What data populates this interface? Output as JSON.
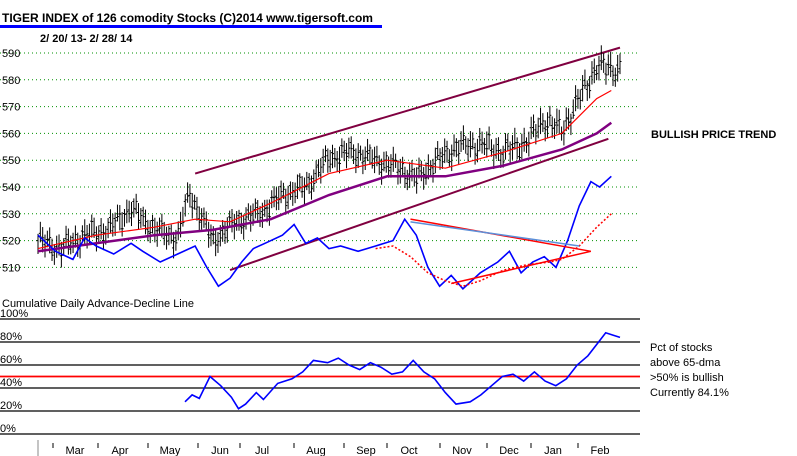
{
  "chart_data": [
    {
      "type": "candlestick",
      "title": "TIGER INDEX of  126 comodity Stocks  (C)2014  www.tigersoft.com",
      "date_range": "2/ 20/ 13-  2/ 28/ 14",
      "y_ticks": [
        "590",
        "580",
        "570",
        "560",
        "550",
        "540",
        "530",
        "520",
        "510"
      ],
      "ylim": [
        505,
        592
      ],
      "x_months": [
        "Mar",
        "Apr",
        "May",
        "Jun",
        "Jul",
        "Aug",
        "Sep",
        "Oct",
        "Nov",
        "Dec",
        "Jan",
        "Feb"
      ],
      "grid": "dotted-horizontal",
      "price_anchors": [
        [
          0,
          520
        ],
        [
          0.04,
          517
        ],
        [
          0.08,
          522
        ],
        [
          0.12,
          524
        ],
        [
          0.16,
          532
        ],
        [
          0.2,
          524
        ],
        [
          0.24,
          521
        ],
        [
          0.26,
          538
        ],
        [
          0.3,
          520
        ],
        [
          0.34,
          527
        ],
        [
          0.38,
          530
        ],
        [
          0.42,
          537
        ],
        [
          0.46,
          540
        ],
        [
          0.5,
          551
        ],
        [
          0.54,
          553
        ],
        [
          0.58,
          550
        ],
        [
          0.62,
          547
        ],
        [
          0.65,
          543
        ],
        [
          0.68,
          549
        ],
        [
          0.72,
          555
        ],
        [
          0.76,
          556
        ],
        [
          0.8,
          553
        ],
        [
          0.84,
          557
        ],
        [
          0.87,
          565
        ],
        [
          0.9,
          561
        ],
        [
          0.93,
          573
        ],
        [
          0.96,
          585
        ],
        [
          0.985,
          584
        ]
      ],
      "series": [
        {
          "name": "price",
          "color": "#000000"
        },
        {
          "name": "21-dma",
          "color": "#ff0000",
          "values": [
            [
              0,
              517
            ],
            [
              0.1,
              522
            ],
            [
              0.2,
              525
            ],
            [
              0.27,
              528
            ],
            [
              0.33,
              527
            ],
            [
              0.4,
              534
            ],
            [
              0.5,
              545
            ],
            [
              0.6,
              550
            ],
            [
              0.7,
              547
            ],
            [
              0.8,
              553
            ],
            [
              0.9,
              560
            ],
            [
              0.96,
              573
            ],
            [
              0.985,
              576
            ]
          ]
        },
        {
          "name": "65-dma",
          "color": "#800080",
          "values": [
            [
              0,
              516
            ],
            [
              0.1,
              519
            ],
            [
              0.2,
              522
            ],
            [
              0.3,
              524
            ],
            [
              0.4,
              528
            ],
            [
              0.5,
              537
            ],
            [
              0.6,
              544
            ],
            [
              0.7,
              544
            ],
            [
              0.8,
              548
            ],
            [
              0.9,
              554
            ],
            [
              0.96,
              560
            ],
            [
              0.985,
              564
            ]
          ]
        }
      ],
      "trend_lines": [
        {
          "from": [
            0.27,
            545
          ],
          "to": [
            1.0,
            592
          ],
          "color": "#800040"
        },
        {
          "from": [
            0.33,
            509
          ],
          "to": [
            0.98,
            558
          ],
          "color": "#800040"
        }
      ],
      "ad_line": {
        "color": "#0000ff",
        "values": [
          [
            0,
            522
          ],
          [
            0.03,
            516
          ],
          [
            0.06,
            513
          ],
          [
            0.08,
            521
          ],
          [
            0.1,
            518
          ],
          [
            0.13,
            515
          ],
          [
            0.16,
            519
          ],
          [
            0.18,
            516
          ],
          [
            0.21,
            512
          ],
          [
            0.24,
            515
          ],
          [
            0.27,
            518
          ],
          [
            0.29,
            510
          ],
          [
            0.31,
            503
          ],
          [
            0.33,
            506
          ],
          [
            0.35,
            512
          ],
          [
            0.37,
            517
          ],
          [
            0.39,
            519
          ],
          [
            0.42,
            522
          ],
          [
            0.44,
            526
          ],
          [
            0.46,
            519
          ],
          [
            0.48,
            521
          ],
          [
            0.5,
            517
          ],
          [
            0.52,
            518
          ],
          [
            0.55,
            516
          ],
          [
            0.58,
            518
          ],
          [
            0.61,
            520
          ],
          [
            0.63,
            528
          ],
          [
            0.65,
            522
          ],
          [
            0.67,
            510
          ],
          [
            0.69,
            503
          ],
          [
            0.71,
            507
          ],
          [
            0.73,
            502
          ],
          [
            0.76,
            508
          ],
          [
            0.79,
            512
          ],
          [
            0.81,
            516
          ],
          [
            0.83,
            508
          ],
          [
            0.85,
            512
          ],
          [
            0.87,
            514
          ],
          [
            0.89,
            510
          ],
          [
            0.9,
            515
          ],
          [
            0.91,
            520
          ],
          [
            0.93,
            533
          ],
          [
            0.95,
            542
          ],
          [
            0.965,
            540
          ],
          [
            0.985,
            544
          ]
        ]
      },
      "ad_ma": {
        "color": "#ff0000",
        "values": [
          [
            0.58,
            517
          ],
          [
            0.61,
            518
          ],
          [
            0.64,
            514
          ],
          [
            0.67,
            508
          ],
          [
            0.7,
            505
          ],
          [
            0.73,
            503
          ],
          [
            0.76,
            505
          ],
          [
            0.8,
            509
          ],
          [
            0.84,
            511
          ],
          [
            0.88,
            512
          ],
          [
            0.9,
            513
          ],
          [
            0.93,
            518
          ],
          [
            0.96,
            525
          ],
          [
            0.985,
            530
          ]
        ]
      },
      "ad_trend_lines": [
        {
          "from": [
            0.64,
            528
          ],
          "to": [
            0.95,
            516
          ],
          "color": "#ff0000"
        },
        {
          "from": [
            0.64,
            527
          ],
          "to": [
            0.93,
            518
          ],
          "color": "#5b8fd9"
        },
        {
          "from": [
            0.71,
            504
          ],
          "to": [
            0.95,
            516
          ],
          "color": "#ff0000"
        }
      ],
      "annotations": [
        "BULLISH PRICE TREND",
        "Cumulative Daily Advance-Decline Line"
      ]
    },
    {
      "type": "line",
      "y_ticks": [
        "100%",
        "80%",
        "60%",
        "40%",
        "20%",
        "0%"
      ],
      "ylim": [
        0,
        100
      ],
      "reference_line": 50,
      "pct_line": {
        "color": "#0000ff",
        "values": [
          [
            0.2,
            28
          ],
          [
            0.22,
            34
          ],
          [
            0.24,
            31
          ],
          [
            0.27,
            50
          ],
          [
            0.3,
            42
          ],
          [
            0.33,
            32
          ],
          [
            0.35,
            22
          ],
          [
            0.37,
            26
          ],
          [
            0.4,
            36
          ],
          [
            0.42,
            30
          ],
          [
            0.46,
            44
          ],
          [
            0.5,
            48
          ],
          [
            0.53,
            54
          ],
          [
            0.56,
            64
          ],
          [
            0.6,
            62
          ],
          [
            0.63,
            66
          ],
          [
            0.66,
            60
          ],
          [
            0.69,
            56
          ],
          [
            0.72,
            62
          ],
          [
            0.75,
            58
          ],
          [
            0.78,
            52
          ],
          [
            0.81,
            54
          ],
          [
            0.84,
            64
          ],
          [
            0.87,
            54
          ],
          [
            0.9,
            48
          ],
          [
            0.93,
            36
          ],
          [
            0.96,
            26
          ],
          [
            1.0,
            28
          ],
          [
            1.03,
            34
          ],
          [
            1.06,
            42
          ],
          [
            1.09,
            50
          ],
          [
            1.12,
            52
          ],
          [
            1.15,
            46
          ],
          [
            1.18,
            54
          ],
          [
            1.21,
            46
          ],
          [
            1.24,
            42
          ],
          [
            1.27,
            48
          ],
          [
            1.3,
            60
          ],
          [
            1.33,
            68
          ],
          [
            1.36,
            80
          ],
          [
            1.38,
            88
          ],
          [
            1.4,
            86
          ],
          [
            1.42,
            84
          ]
        ]
      },
      "labels": {
        "line1": "Pct of stocks",
        "line2": "above 65-dma",
        "line3": ">50% is bullish",
        "line4": "Currently  84.1%"
      }
    }
  ],
  "colors": {
    "price_bars": "#000000",
    "ma21": "#ff0000",
    "ma65": "#800080",
    "trend": "#800040",
    "ad_line": "#0000ff",
    "pct_line": "#0000ff",
    "ref_line": "#ff0000",
    "title_underline": "#0000ff"
  }
}
